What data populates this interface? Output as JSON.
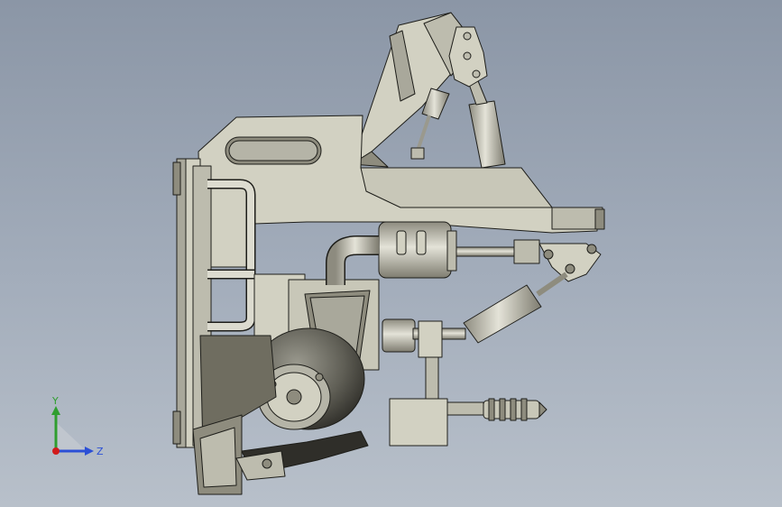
{
  "viewport": {
    "background_top": "#8b96a6",
    "background_bottom": "#b8c0ca",
    "part_fill": "#d2d1c2",
    "part_dark": "#8e8c7e",
    "part_shadow": "#6f6d60",
    "edge": "#1e1e1a",
    "metal": "#b9b8ae"
  },
  "triad": {
    "y_label": "Y",
    "z_label": "Z",
    "y_color": "#2f9e2f",
    "z_color": "#2b4fd6",
    "origin_color": "#d11b1b"
  }
}
